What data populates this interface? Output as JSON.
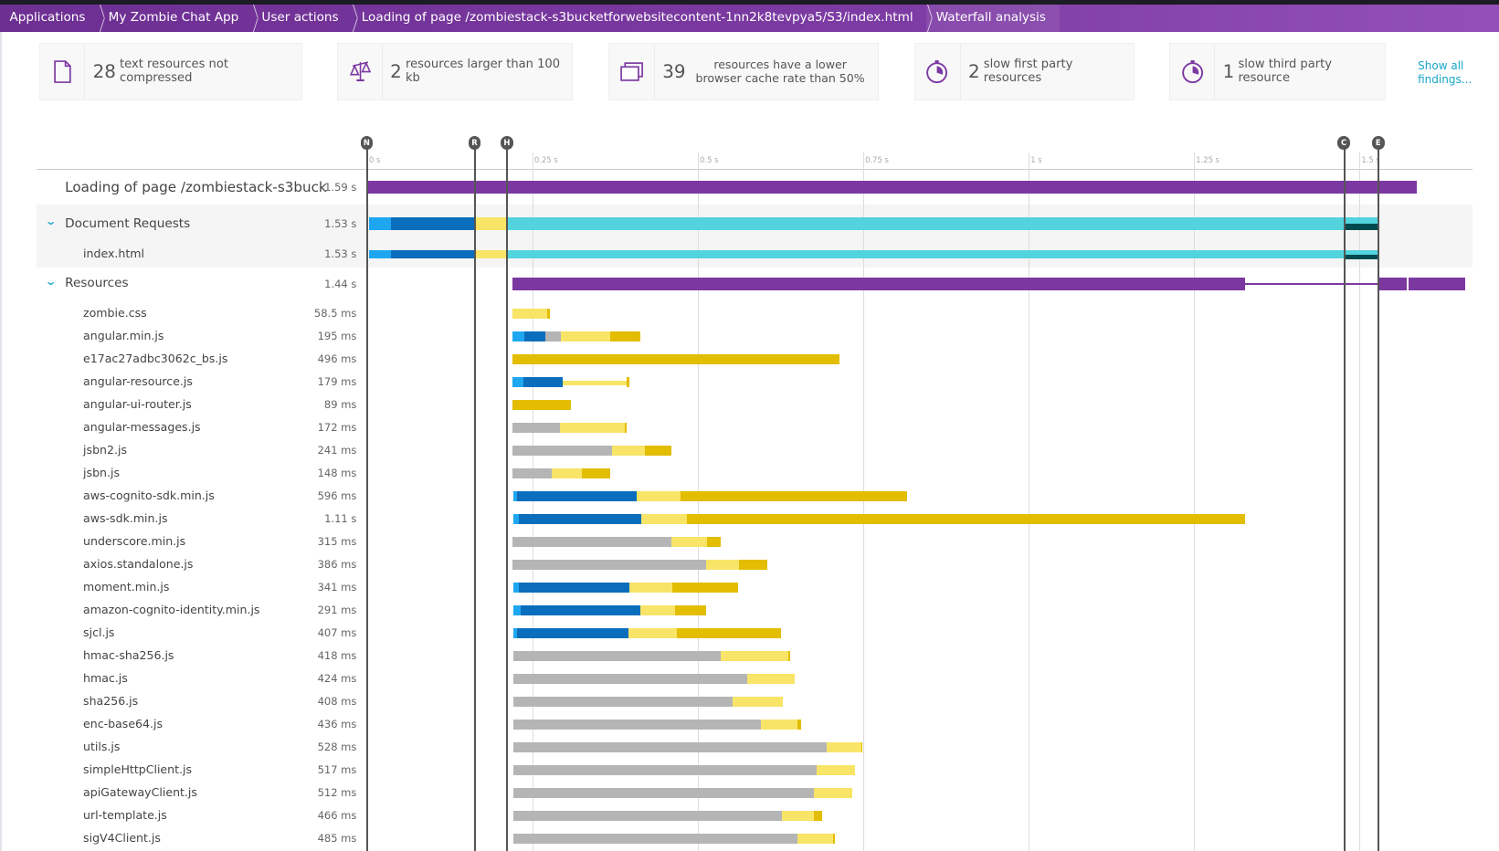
{
  "breadcrumbs": [
    {
      "label": "Applications"
    },
    {
      "label": "My Zombie Chat App"
    },
    {
      "label": "User actions"
    },
    {
      "label": "Loading of page /zombiestack-s3bucketforwebsitecontent-1nn2k8tevpya5/S3/index.html"
    },
    {
      "label": "Waterfall analysis"
    }
  ],
  "findings": [
    {
      "icon": "document-icon",
      "count": "28",
      "text": "text resources not compressed"
    },
    {
      "icon": "scale-icon",
      "count": "2",
      "text": "resources larger than 100 kb"
    },
    {
      "icon": "cache-icon",
      "count": "39",
      "text": "resources have a lower browser cache rate than 50%"
    },
    {
      "icon": "stopwatch-icon",
      "count": "2",
      "text": "slow first party resources"
    },
    {
      "icon": "stopwatch-icon",
      "count": "1",
      "text": "slow third party resource"
    }
  ],
  "show_all": "Show all findings...",
  "colors": {
    "purple": "#7c38a1",
    "dns": "#1ea7f0",
    "connect": "#0a6ebd",
    "wait": "#b5b5b5",
    "ttfb": "#f8e467",
    "download": "#e2bd00",
    "teal": "#52d3de",
    "darkteal": "#00494f"
  },
  "chart_data": {
    "type": "table",
    "axis": {
      "unit": "ms",
      "ticks": [
        {
          "label": "0 s",
          "ms": 0
        },
        {
          "label": "0.25 s",
          "ms": 250
        },
        {
          "label": "0.5 s",
          "ms": 500
        },
        {
          "label": "0.75 s",
          "ms": 750
        },
        {
          "label": "1 s",
          "ms": 1000
        },
        {
          "label": "1.25 s",
          "ms": 1250
        },
        {
          "label": "1.5 s",
          "ms": 1500
        }
      ]
    },
    "markers": [
      {
        "label": "N",
        "ms": 0
      },
      {
        "label": "R",
        "ms": 163
      },
      {
        "label": "H",
        "ms": 212
      },
      {
        "label": "C",
        "ms": 1477
      },
      {
        "label": "E",
        "ms": 1529
      }
    ],
    "rows": [
      {
        "name": "Loading of page /zombiestack-s3buck",
        "duration": "1.59 s",
        "kind": "page",
        "segments": [
          [
            "purple",
            0,
            1587
          ]
        ]
      },
      {
        "name": "Document Requests",
        "duration": "1.53 s",
        "kind": "group",
        "segments": [
          [
            "dns",
            3,
            36
          ],
          [
            "connect",
            36,
            163
          ],
          [
            "ttfb",
            163,
            212
          ],
          [
            "teal",
            212,
            1477
          ],
          [
            "darkteal",
            1477,
            1527
          ]
        ]
      },
      {
        "name": "index.html",
        "duration": "1.53 s",
        "kind": "doc",
        "segments": [
          [
            "dns",
            3,
            36
          ],
          [
            "connect",
            36,
            163
          ],
          [
            "ttfb",
            163,
            212
          ],
          [
            "teal",
            212,
            1477
          ],
          [
            "darkteal",
            1477,
            1527
          ]
        ]
      },
      {
        "name": "Resources",
        "duration": "1.44 s",
        "kind": "group",
        "segments": [
          [
            "purple",
            220,
            1327
          ],
          [
            "line",
            1327,
            1529
          ],
          [
            "purple",
            1529,
            1572
          ],
          [
            "purple",
            1574,
            1660
          ]
        ]
      },
      {
        "name": "zombie.css",
        "duration": "58.5 ms",
        "segments": [
          [
            "ttfb",
            220,
            272
          ],
          [
            "download",
            272,
            277
          ]
        ]
      },
      {
        "name": "angular.min.js",
        "duration": "195 ms",
        "segments": [
          [
            "dns",
            220,
            238
          ],
          [
            "connect",
            238,
            270
          ],
          [
            "wait",
            270,
            293
          ],
          [
            "ttfb",
            293,
            367
          ],
          [
            "download",
            367,
            413
          ]
        ]
      },
      {
        "name": "e17ac27adbc3062c_bs.js",
        "duration": "496 ms",
        "segments": [
          [
            "download",
            220,
            714
          ]
        ]
      },
      {
        "name": "angular-resource.js",
        "duration": "179 ms",
        "segments": [
          [
            "dns",
            220,
            236
          ],
          [
            "connect",
            236,
            295
          ],
          [
            "ttfbthin",
            295,
            392
          ],
          [
            "download",
            392,
            397
          ]
        ]
      },
      {
        "name": "angular-ui-router.js",
        "duration": "89 ms",
        "segments": [
          [
            "download",
            220,
            308
          ]
        ]
      },
      {
        "name": "angular-messages.js",
        "duration": "172 ms",
        "segments": [
          [
            "wait",
            220,
            292
          ],
          [
            "ttfb",
            292,
            390
          ],
          [
            "download",
            390,
            392
          ]
        ]
      },
      {
        "name": "jsbn2.js",
        "duration": "241 ms",
        "segments": [
          [
            "wait",
            220,
            370
          ],
          [
            "ttfb",
            370,
            420
          ],
          [
            "download",
            420,
            460
          ]
        ]
      },
      {
        "name": "jsbn.js",
        "duration": "148 ms",
        "segments": [
          [
            "wait",
            220,
            279
          ],
          [
            "ttfb",
            279,
            325
          ],
          [
            "download",
            325,
            367
          ]
        ]
      },
      {
        "name": "aws-cognito-sdk.min.js",
        "duration": "596 ms",
        "segments": [
          [
            "dns",
            221,
            226
          ],
          [
            "connect",
            226,
            408
          ],
          [
            "ttfb",
            408,
            474
          ],
          [
            "download",
            474,
            816
          ]
        ]
      },
      {
        "name": "aws-sdk.min.js",
        "duration": "1.11 s",
        "segments": [
          [
            "dns",
            221,
            230
          ],
          [
            "connect",
            230,
            414
          ],
          [
            "ttfb",
            414,
            483
          ],
          [
            "download",
            483,
            1327
          ]
        ]
      },
      {
        "name": "underscore.min.js",
        "duration": "315 ms",
        "segments": [
          [
            "wait",
            220,
            460
          ],
          [
            "ttfb",
            460,
            514
          ],
          [
            "download",
            514,
            535
          ]
        ]
      },
      {
        "name": "axios.standalone.js",
        "duration": "386 ms",
        "segments": [
          [
            "wait",
            220,
            512
          ],
          [
            "ttfb",
            512,
            562
          ],
          [
            "download",
            562,
            605
          ]
        ]
      },
      {
        "name": "moment.min.js",
        "duration": "341 ms",
        "segments": [
          [
            "dns",
            221,
            230
          ],
          [
            "connect",
            230,
            396
          ],
          [
            "ttfb",
            396,
            461
          ],
          [
            "download",
            461,
            561
          ]
        ]
      },
      {
        "name": "amazon-cognito-identity.min.js",
        "duration": "291 ms",
        "segments": [
          [
            "dns",
            221,
            232
          ],
          [
            "connect",
            232,
            413
          ],
          [
            "ttfb",
            413,
            465
          ],
          [
            "download",
            465,
            512
          ]
        ]
      },
      {
        "name": "sjcl.js",
        "duration": "407 ms",
        "segments": [
          [
            "dns",
            221,
            226
          ],
          [
            "connect",
            226,
            395
          ],
          [
            "ttfb",
            395,
            468
          ],
          [
            "download",
            468,
            626
          ]
        ]
      },
      {
        "name": "hmac-sha256.js",
        "duration": "418 ms",
        "segments": [
          [
            "wait",
            221,
            535
          ],
          [
            "ttfb",
            535,
            636
          ],
          [
            "download",
            636,
            639
          ]
        ]
      },
      {
        "name": "hmac.js",
        "duration": "424 ms",
        "segments": [
          [
            "wait",
            221,
            575
          ],
          [
            "ttfb",
            575,
            647
          ]
        ]
      },
      {
        "name": "sha256.js",
        "duration": "408 ms",
        "segments": [
          [
            "wait",
            221,
            553
          ],
          [
            "ttfb",
            553,
            629
          ]
        ]
      },
      {
        "name": "enc-base64.js",
        "duration": "436 ms",
        "segments": [
          [
            "wait",
            221,
            595
          ],
          [
            "ttfb",
            595,
            650
          ],
          [
            "download",
            650,
            656
          ]
        ]
      },
      {
        "name": "utils.js",
        "duration": "528 ms",
        "segments": [
          [
            "wait",
            221,
            695
          ],
          [
            "ttfb",
            695,
            747
          ],
          [
            "download",
            747,
            749
          ]
        ]
      },
      {
        "name": "simpleHttpClient.js",
        "duration": "517 ms",
        "segments": [
          [
            "wait",
            221,
            679
          ],
          [
            "ttfb",
            679,
            737
          ]
        ]
      },
      {
        "name": "apiGatewayClient.js",
        "duration": "512 ms",
        "segments": [
          [
            "wait",
            221,
            675
          ],
          [
            "ttfb",
            675,
            733
          ]
        ]
      },
      {
        "name": "url-template.js",
        "duration": "466 ms",
        "segments": [
          [
            "wait",
            221,
            627
          ],
          [
            "ttfb",
            627,
            675
          ],
          [
            "download",
            675,
            688
          ]
        ]
      },
      {
        "name": "sigV4Client.js",
        "duration": "485 ms",
        "segments": [
          [
            "wait",
            221,
            650
          ],
          [
            "ttfb",
            650,
            704
          ],
          [
            "download",
            704,
            707
          ]
        ]
      }
    ]
  }
}
